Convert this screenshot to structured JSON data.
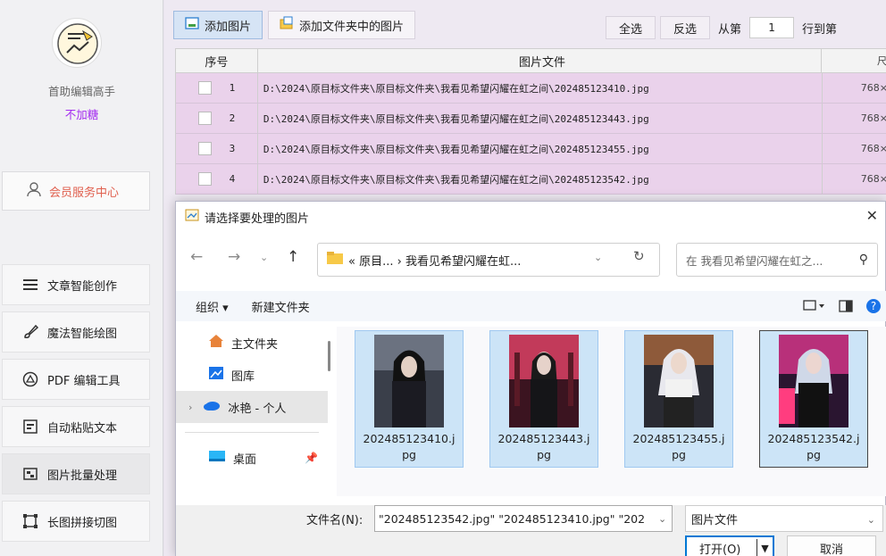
{
  "sidebar": {
    "app_name": "首助编辑高手",
    "app_sub": "不加糖",
    "member_label": "会员服务中心",
    "menu": [
      {
        "label": "文章智能创作",
        "icon": "lines-icon"
      },
      {
        "label": "魔法智能绘图",
        "icon": "brush-icon"
      },
      {
        "label": "PDF 编辑工具",
        "icon": "pdf-icon"
      },
      {
        "label": "自动粘贴文本",
        "icon": "paste-icon"
      },
      {
        "label": "图片批量处理",
        "icon": "image-batch-icon"
      },
      {
        "label": "长图拼接切图",
        "icon": "crop-icon"
      }
    ]
  },
  "toolbar": {
    "add_image": "添加图片",
    "add_folder": "添加文件夹中的图片",
    "select_all": "全选",
    "invert": "反选",
    "from_label": "从第",
    "from_value": "1",
    "to_label": "行到第"
  },
  "table": {
    "headers": {
      "idx": "序号",
      "file": "图片文件",
      "size": "尺"
    },
    "rows": [
      {
        "idx": "1",
        "file": "D:\\2024\\原目标文件夹\\原目标文件夹\\我看见希望闪耀在虹之间\\202485123410.jpg",
        "size": "768×"
      },
      {
        "idx": "2",
        "file": "D:\\2024\\原目标文件夹\\原目标文件夹\\我看见希望闪耀在虹之间\\202485123443.jpg",
        "size": "768×"
      },
      {
        "idx": "3",
        "file": "D:\\2024\\原目标文件夹\\原目标文件夹\\我看见希望闪耀在虹之间\\202485123455.jpg",
        "size": "768×"
      },
      {
        "idx": "4",
        "file": "D:\\2024\\原目标文件夹\\原目标文件夹\\我看见希望闪耀在虹之间\\202485123542.jpg",
        "size": "768×"
      }
    ]
  },
  "dialog": {
    "title": "请选择要处理的图片",
    "address": "« 原目... › 我看见希望闪耀在虹...",
    "search_placeholder": "在 我看见希望闪耀在虹之...",
    "organize": "组织 ▾",
    "new_folder": "新建文件夹",
    "nav": [
      {
        "label": "主文件夹",
        "icon": "home-icon"
      },
      {
        "label": "图库",
        "icon": "gallery-icon"
      },
      {
        "label": "冰艳 - 个人",
        "icon": "cloud-icon"
      },
      {
        "label": "桌面",
        "icon": "desktop-icon"
      }
    ],
    "files": [
      {
        "name": "202485123410.jpg",
        "accent": "#3a3f4a"
      },
      {
        "name": "202485123443.jpg",
        "accent": "#c23a5a"
      },
      {
        "name": "202485123455.jpg",
        "accent": "#8e5a3a"
      },
      {
        "name": "202485123542.jpg",
        "accent": "#b8307a"
      }
    ],
    "filename_label": "文件名(N):",
    "filename_value": "\"202485123542.jpg\" \"202485123410.jpg\" \"202",
    "filetype": "图片文件",
    "open": "打开(O)",
    "cancel": "取消"
  }
}
